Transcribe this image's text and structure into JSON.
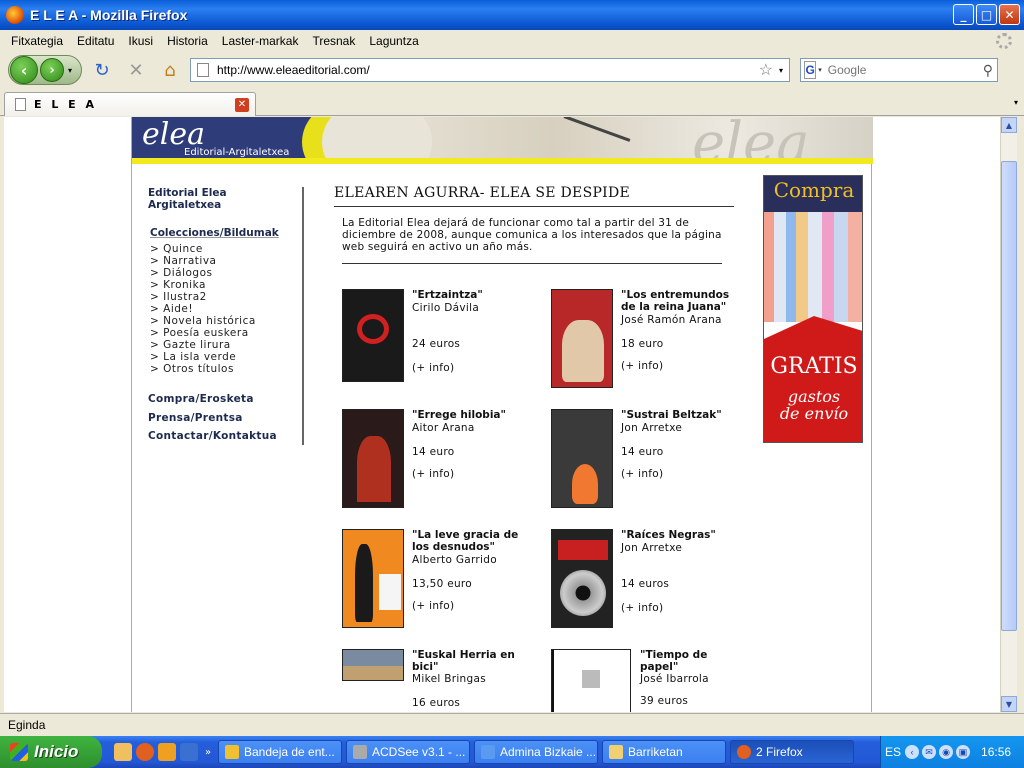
{
  "window": {
    "title": "E L E A - Mozilla Firefox",
    "btn_minimize": "_",
    "btn_maximize": "□",
    "btn_close": "✕"
  },
  "menu": [
    "Fitxategia",
    "Editatu",
    "Ikusi",
    "Historia",
    "Laster-markak",
    "Tresnak",
    "Laguntza"
  ],
  "nav": {
    "back_glyph": "‹",
    "forward_glyph": "›",
    "reload_glyph": "↻",
    "stop_glyph": "✕",
    "home_glyph": "⌂",
    "dropdown_glyph": "▾",
    "url": "http://www.eleaeditorial.com/",
    "star_glyph": "☆",
    "search_engine": "G",
    "search_placeholder": "Google",
    "search_glyph": "⚲"
  },
  "tab": {
    "label": "E L E A",
    "close_glyph": "✕",
    "menu_glyph": "▾"
  },
  "scrollbar": {
    "up_glyph": "▲",
    "down_glyph": "▼"
  },
  "site": {
    "banner_logo": "elea",
    "banner_sub": "Editorial-Argitaletxea",
    "banner_ghost": "elea",
    "sidebar": {
      "title": "Editorial Elea Argitaletxea",
      "collections_head": "Colecciones/Bildumak",
      "collections": [
        "> Quince",
        "> Narrativa",
        "> Diálogos",
        "> Kronika",
        "> Ilustra2",
        "> Aide!",
        "> Novela histórica",
        "> Poesía euskera",
        "> Gazte lirura",
        "> La isla verde",
        "> Otros títulos"
      ],
      "links": [
        "Compra/Erosketa",
        "Prensa/Prentsa",
        "Contactar/Kontaktua"
      ]
    },
    "main": {
      "heading": "ELEAREN AGURRA- ELEA SE DESPIDE",
      "intro": "La Editorial Elea dejará de funcionar como tal a partir del 31 de diciembre de 2008, aunque comunica a los interesados que la página web seguirá en activo un año más."
    },
    "books": [
      {
        "title": "\"Ertzaintza\"",
        "author": "Cirilo Dávila",
        "price": "24 euros",
        "info": "(+ info)",
        "cover_color": "#1a1a1a",
        "accent": "#d02020"
      },
      {
        "title": "\"Los entremundos de la reina Juana\"",
        "author": "José Ramón Arana",
        "price": "18 euro",
        "info": "(+ info)",
        "cover_color": "#c03030",
        "accent": "#e0c8a8"
      },
      {
        "title": "\"Errege hilobia\"",
        "author": "Aitor Arana",
        "price": "14 euro",
        "info": "(+ info)",
        "cover_color": "#2a1a1a",
        "accent": "#c03020"
      },
      {
        "title": "\"Sustrai Beltzak\"",
        "author": "Jon Arretxe",
        "price": "14 euro",
        "info": "(+ info)",
        "cover_color": "#3a3a3a",
        "accent": "#f07830"
      },
      {
        "title": "\"La leve gracia de los desnudos\"",
        "author": "Alberto Garrido",
        "price": "13,50 euro",
        "info": "(+ info)",
        "cover_color": "#f08a20",
        "accent": "#1a1a1a"
      },
      {
        "title": "\"Raíces Negras\"",
        "author": "Jon Arretxe",
        "price": "14 euros",
        "info": "(+ info)",
        "cover_color": "#222",
        "accent": "#d02020"
      },
      {
        "title": "\"Euskal Herria en bici\"",
        "author": "Mikel Bringas",
        "price": "16 euros",
        "info": "",
        "cover_color": "#7a8aa0",
        "accent": "#c0a070"
      },
      {
        "title": "\"Tiempo de papel\"",
        "author": "José Ibarrola",
        "price": "39 euros",
        "info": "",
        "cover_color": "#ffffff",
        "accent": "#555"
      }
    ],
    "ad": {
      "top": "Compra",
      "middle": "GRATIS",
      "bottom1": "gastos",
      "bottom2": "de envío"
    }
  },
  "status": "Egindа",
  "taskbar": {
    "start": "Inicio",
    "tasks": [
      "Bandeja de ent...",
      "ACDSee v3.1 - ...",
      "Admina Bizkaie ...",
      "Barriketan",
      "2 Firefox"
    ],
    "lang": "ES",
    "clock": "16:56"
  }
}
